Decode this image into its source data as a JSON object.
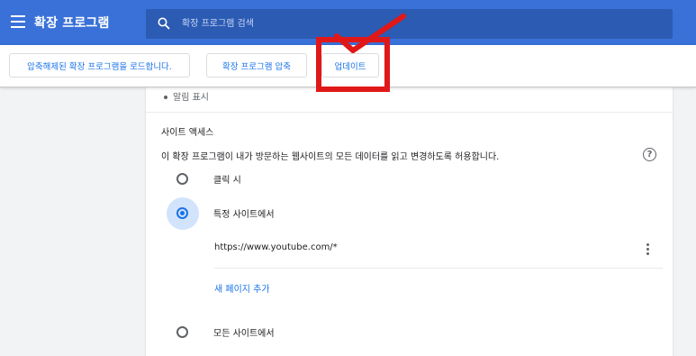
{
  "header": {
    "title": "확장 프로그램",
    "search_placeholder": "확장 프로그램 검색"
  },
  "toolbar": {
    "load_unpacked_label": "압축해제된 확장 프로그램을 로드합니다.",
    "pack_label": "확장 프로그램 압축",
    "update_label": "업데이트"
  },
  "details": {
    "bullet_text": "알림 표시",
    "site_access_title": "사이트 액세스",
    "site_access_desc": "이 확장 프로그램이 내가 방문하는 웹사이트의 모든 데이터를 읽고 변경하도록 허용합니다.",
    "options": [
      {
        "label": "클릭 시",
        "checked": false
      },
      {
        "label": "특정 사이트에서",
        "checked": true
      },
      {
        "label": "모든 사이트에서",
        "checked": false
      }
    ],
    "site_url": "https://www.youtube.com/*",
    "add_page_label": "새 페이지 추가",
    "help_glyph": "?"
  },
  "colors": {
    "header_bg": "#3a71d8",
    "accent": "#1a73e8",
    "annotation_red": "#e01818"
  }
}
